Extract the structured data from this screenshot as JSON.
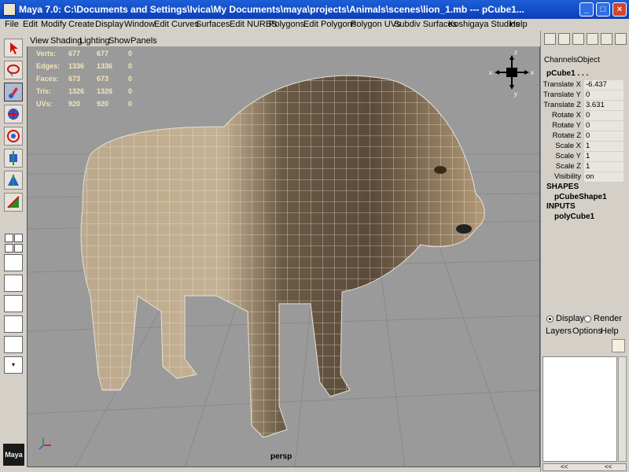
{
  "window": {
    "title": "Maya 7.0: C:\\Documents and Settings\\Ivica\\My Documents\\maya\\projects\\Animals\\scenes\\lion_1.mb   ---   pCube1...",
    "minimize": "_",
    "maximize": "□",
    "close": "×"
  },
  "menu": [
    "File",
    "Edit",
    "Modify",
    "Create",
    "Display",
    "Window",
    "Edit Curves",
    "Surfaces",
    "Edit NURBS",
    "Polygons",
    "Edit Polygons",
    "Polygon UVs",
    "Subdiv Surfaces",
    "Koshigaya Studios",
    "Help"
  ],
  "viewport": {
    "menu": [
      "View",
      "Shading",
      "Lighting",
      "Show",
      "Panels"
    ],
    "hud": [
      {
        "label": "Verts:",
        "a": "677",
        "b": "677",
        "c": "0"
      },
      {
        "label": "Edges:",
        "a": "1336",
        "b": "1336",
        "c": "0"
      },
      {
        "label": "Faces:",
        "a": "673",
        "b": "673",
        "c": "0"
      },
      {
        "label": "Tris:",
        "a": "1326",
        "b": "1326",
        "c": "0"
      },
      {
        "label": "UVs:",
        "a": "920",
        "b": "920",
        "c": "0"
      }
    ],
    "camera": "persp",
    "gizmo_labels": {
      "top": "z",
      "left": "x",
      "right": "x",
      "bottom": "y"
    }
  },
  "channel_box": {
    "tabs": [
      "Channels",
      "Object"
    ],
    "object_name": "pCube1 . . .",
    "attributes": [
      {
        "label": "Translate X",
        "value": "-6.437"
      },
      {
        "label": "Translate Y",
        "value": "0"
      },
      {
        "label": "Translate Z",
        "value": "3.631"
      },
      {
        "label": "Rotate X",
        "value": "0"
      },
      {
        "label": "Rotate Y",
        "value": "0"
      },
      {
        "label": "Rotate Z",
        "value": "0"
      },
      {
        "label": "Scale X",
        "value": "1"
      },
      {
        "label": "Scale Y",
        "value": "1"
      },
      {
        "label": "Scale Z",
        "value": "1"
      },
      {
        "label": "Visibility",
        "value": "on"
      }
    ],
    "shapes_header": "SHAPES",
    "shape_name": "pCubeShape1",
    "inputs_header": "INPUTS",
    "input_name": "polyCube1"
  },
  "layers": {
    "display_label": "Display",
    "render_label": "Render",
    "menu": [
      "Layers",
      "Options",
      "Help"
    ],
    "nav_left": "<<",
    "nav_right": "<<"
  },
  "logo_text": "Maya",
  "colors": {
    "hud_text": "#f4e7b4",
    "viewport_bg": "#9a9a9a",
    "title_bar": "#0b3fb8"
  }
}
